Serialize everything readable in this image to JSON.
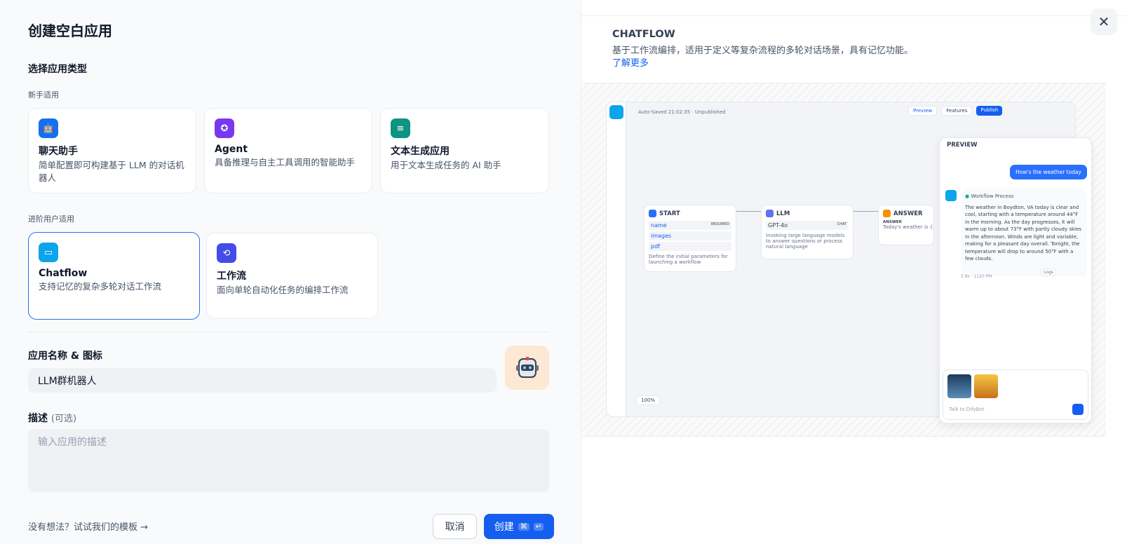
{
  "dialog": {
    "title": "创建空白应用",
    "close_icon": "close-icon"
  },
  "type_section": {
    "label": "选择应用类型",
    "beginner_label": "新手适用",
    "advanced_label": "进阶用户适用"
  },
  "cards": [
    {
      "title": "聊天助手",
      "desc": "简单配置即可构建基于 LLM 的对话机器人",
      "color": "#1570ef",
      "icon": "chat-bot-icon"
    },
    {
      "title": "Agent",
      "desc": "具备推理与自主工具调用的智能助手",
      "color": "#7839ee",
      "icon": "agent-icon"
    },
    {
      "title": "文本生成应用",
      "desc": "用于文本生成任务的 AI 助手",
      "color": "#0e9384",
      "icon": "text-generation-icon"
    },
    {
      "title": "Chatflow",
      "desc": "支持记忆的复杂多轮对话工作流",
      "color": "#0ba5ec",
      "icon": "chatflow-icon",
      "selected": true
    },
    {
      "title": "工作流",
      "desc": "面向单轮自动化任务的编排工作流",
      "color": "#444ce7",
      "icon": "workflow-icon"
    }
  ],
  "name_section": {
    "label": "应用名称 & 图标",
    "value": "LLM群机器人"
  },
  "desc_section": {
    "label": "描述",
    "optional": "(可选)",
    "placeholder": "输入应用的描述"
  },
  "footer": {
    "template_link": "没有想法？试试我们的模板",
    "cancel": "取消",
    "create": "创建",
    "shortcut1": "⌘",
    "shortcut2": "↵"
  },
  "info": {
    "title": "CHATFLOW",
    "desc": "基于工作流编排，适用于定义等复杂流程的多轮对话场景，具有记忆功能。",
    "learn_more": "了解更多"
  },
  "mock": {
    "autosave": "Auto-Saved 21:02:35 · Unpublished",
    "preview_btn": "Preview",
    "features_btn": "Features",
    "publish_btn": "Publish",
    "start": {
      "title": "START",
      "vars": [
        "name",
        "images",
        "pdf"
      ],
      "required": "REQUIRED",
      "desc": "Define the initial parameters for launching a workflow"
    },
    "llm": {
      "title": "LLM",
      "model": "GPT-4o",
      "chat": "CHAT",
      "desc": "Invoking large language models to answer questions or process natural language"
    },
    "answer": {
      "title": "ANSWER",
      "label": "ANSWER",
      "desc": "Today's weather is {{#...}} entities to extract."
    },
    "zoom": "100%",
    "preview": {
      "title": "PREVIEW",
      "user_msg": "How's the weather today",
      "process": "Workflow Process",
      "reply": "The weather in Boydton, VA today is clear and cool, starting with a temperature around 44°F in the morning. As the day progresses, it will warm up to about 73°F with partly cloudy skies in the afternoon. Winds are light and variable, making for a pleasant day overall. Tonight, the temperature will drop to around 50°F with a few clouds.",
      "logs": "Logs",
      "time": "5.8s · 1120 PM",
      "input_placeholder": "Talk to DifyBot"
    }
  }
}
